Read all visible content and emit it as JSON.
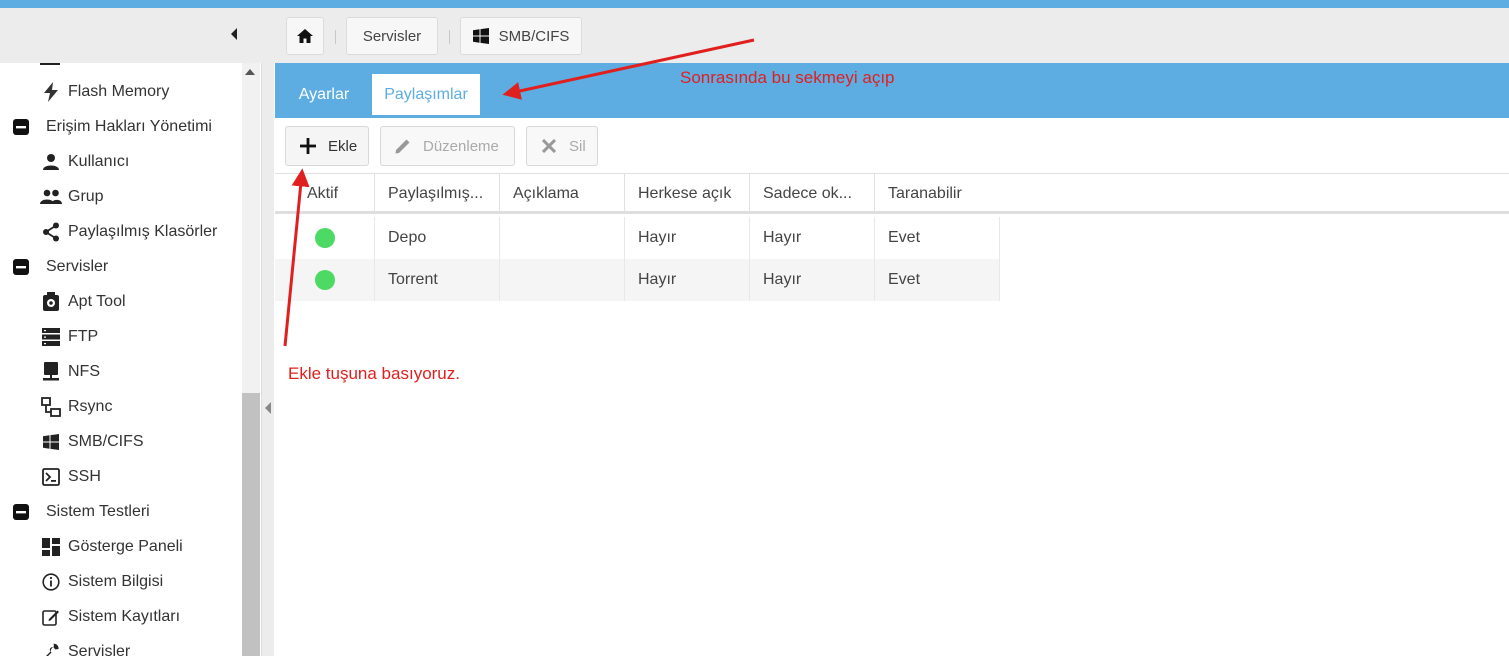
{
  "header": {
    "breadcrumbs": [
      {
        "label": ""
      },
      {
        "label": "Servisler"
      },
      {
        "label": "SMB/CIFS"
      }
    ]
  },
  "sidebar": {
    "items": [
      {
        "label": "Flash Memory",
        "icon": "flash-icon",
        "group": false
      },
      {
        "label": "Erişim Hakları Yönetimi",
        "icon": "minus-box-icon",
        "group": true
      },
      {
        "label": "Kullanıcı",
        "icon": "user-icon",
        "group": false
      },
      {
        "label": "Grup",
        "icon": "group-icon",
        "group": false
      },
      {
        "label": "Paylaşılmış Klasörler",
        "icon": "share-icon",
        "group": false
      },
      {
        "label": "Servisler",
        "icon": "minus-box-icon",
        "group": true
      },
      {
        "label": "Apt Tool",
        "icon": "apt-icon",
        "group": false
      },
      {
        "label": "FTP",
        "icon": "server-icon",
        "group": false
      },
      {
        "label": "NFS",
        "icon": "nfs-icon",
        "group": false
      },
      {
        "label": "Rsync",
        "icon": "rsync-icon",
        "group": false
      },
      {
        "label": "SMB/CIFS",
        "icon": "windows-icon",
        "group": false
      },
      {
        "label": "SSH",
        "icon": "terminal-icon",
        "group": false
      },
      {
        "label": "Sistem Testleri",
        "icon": "minus-box-icon",
        "group": true
      },
      {
        "label": "Gösterge Paneli",
        "icon": "dashboard-icon",
        "group": false
      },
      {
        "label": "Sistem Bilgisi",
        "icon": "info-icon",
        "group": false
      },
      {
        "label": "Sistem Kayıtları",
        "icon": "edit-icon",
        "group": false
      },
      {
        "label": "Servisler",
        "icon": "wrench-icon",
        "group": false
      }
    ]
  },
  "tabs": [
    {
      "label": "Ayarlar",
      "active": false
    },
    {
      "label": "Paylaşımlar",
      "active": true
    }
  ],
  "toolbar": {
    "add_label": "Ekle",
    "edit_label": "Düzenleme",
    "delete_label": "Sil"
  },
  "table": {
    "columns": [
      "Aktif",
      "Paylaşılmış...",
      "Açıklama",
      "Herkese açık",
      "Sadece ok...",
      "Taranabilir"
    ],
    "rows": [
      {
        "active": true,
        "name": "Depo",
        "description": "",
        "public": "Hayır",
        "readonly": "Hayır",
        "browseable": "Evet"
      },
      {
        "active": true,
        "name": "Torrent",
        "description": "",
        "public": "Hayır",
        "readonly": "Hayır",
        "browseable": "Evet"
      }
    ]
  },
  "annotations": {
    "tab_note": "Sonrasında bu sekmeyi açıp",
    "add_note": "Ekle tuşuna basıyoruz."
  },
  "colors": {
    "accent": "#5dade2",
    "active_status": "#4cd964",
    "annotation": "#e0201e"
  }
}
